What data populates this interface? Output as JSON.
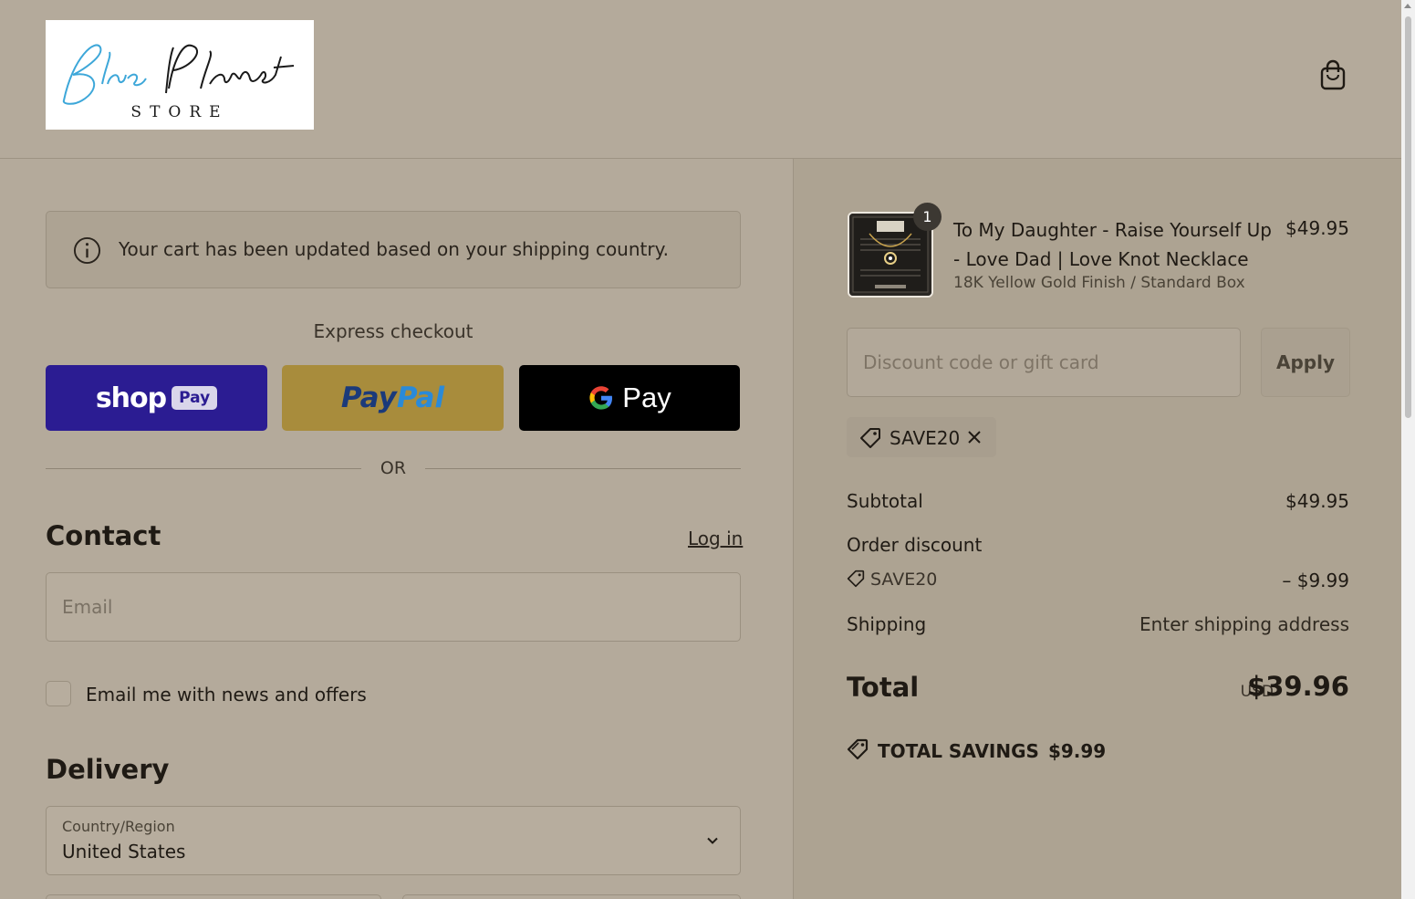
{
  "header": {
    "logo_text": "BluePlanet STORE",
    "cart_icon": "shopping-bag-icon"
  },
  "notice": {
    "icon": "info-icon",
    "text": "Your cart has been updated based on your shipping country."
  },
  "express": {
    "label": "Express checkout",
    "shop_pay": {
      "word": "shop",
      "badge": "Pay"
    },
    "paypal": {
      "part1": "Pay",
      "part2": "Pal"
    },
    "gpay": {
      "word": "Pay"
    },
    "or_text": "OR"
  },
  "contact": {
    "title": "Contact",
    "login_label": "Log in",
    "email_placeholder": "Email",
    "newsletter_label": "Email me with news and offers"
  },
  "delivery": {
    "title": "Delivery",
    "country_label": "Country/Region",
    "country_value": "United States"
  },
  "order": {
    "item": {
      "quantity": "1",
      "name": "To My Daughter - Raise Yourself Up - Love Dad | Love Knot Necklace",
      "variant": "18K Yellow Gold Finish / Standard Box",
      "price": "$49.95"
    },
    "discount_placeholder": "Discount code or gift card",
    "apply_label": "Apply",
    "applied_code": "SAVE20",
    "subtotal_label": "Subtotal",
    "subtotal_value": "$49.95",
    "order_discount_label": "Order discount",
    "order_discount_code": "SAVE20",
    "order_discount_value": "– $9.99",
    "shipping_label": "Shipping",
    "shipping_value": "Enter shipping address",
    "total_label": "Total",
    "total_currency": "USD",
    "total_value": "$39.96",
    "savings_label": "TOTAL SAVINGS",
    "savings_value": "$9.99"
  },
  "colors": {
    "background": "#b4aa9b",
    "summary_background": "#ada392",
    "shop_pay": "#2b1c92",
    "paypal": "#a88c3c",
    "gpay": "#000000"
  }
}
